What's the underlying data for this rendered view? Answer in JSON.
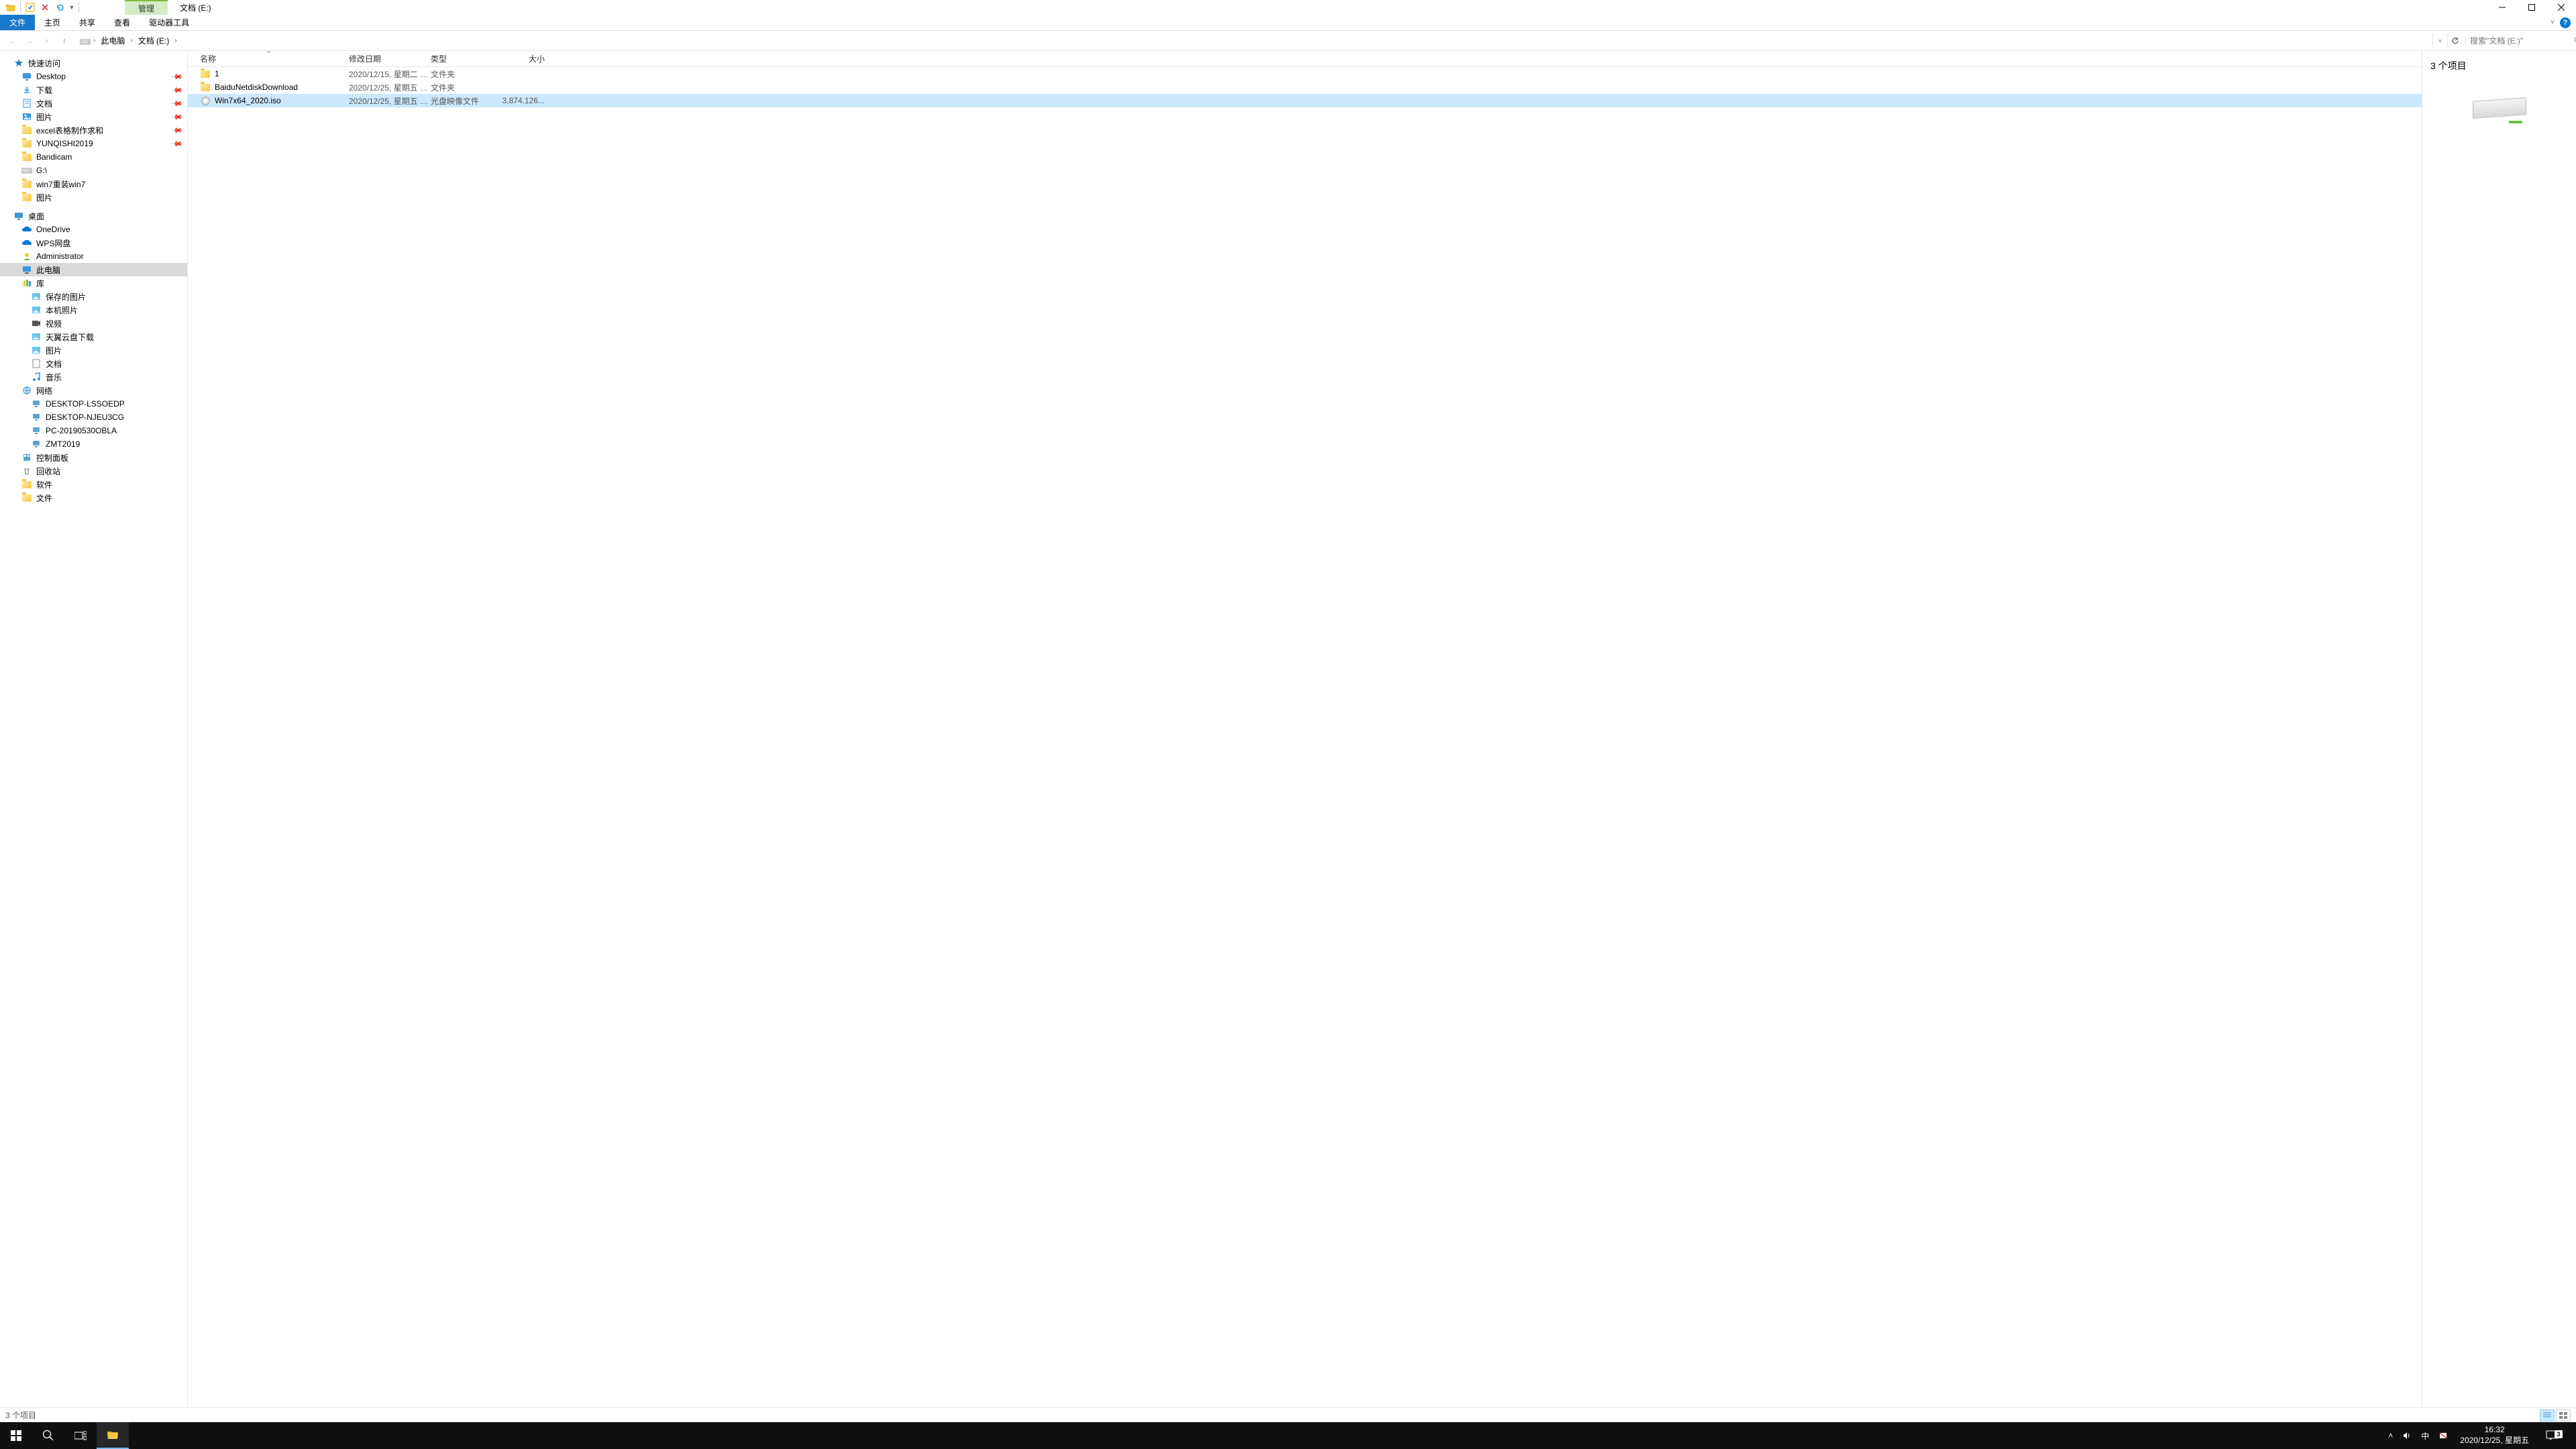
{
  "titlebar": {
    "context_tab": "管理",
    "title": "文档 (E:)"
  },
  "ribbon": {
    "file": "文件",
    "tabs": [
      "主页",
      "共享",
      "查看",
      "驱动器工具"
    ]
  },
  "address": {
    "segments": [
      "此电脑",
      "文档 (E:)"
    ]
  },
  "search": {
    "placeholder": "搜索\"文档 (E:)\""
  },
  "tree": {
    "quick_access": "快速访问",
    "quick_items": [
      {
        "label": "Desktop",
        "icon": "desktop",
        "pinned": true
      },
      {
        "label": "下载",
        "icon": "download",
        "pinned": true
      },
      {
        "label": "文档",
        "icon": "doc",
        "pinned": true
      },
      {
        "label": "图片",
        "icon": "pic",
        "pinned": true
      },
      {
        "label": "excel表格制作求和",
        "icon": "folder",
        "pinned": true
      },
      {
        "label": "YUNQISHI2019",
        "icon": "folder",
        "pinned": true
      },
      {
        "label": "Bandicam",
        "icon": "folder",
        "pinned": false
      },
      {
        "label": "G:\\",
        "icon": "drive",
        "pinned": false
      },
      {
        "label": "win7重装win7",
        "icon": "folder",
        "pinned": false
      },
      {
        "label": "图片",
        "icon": "folder",
        "pinned": false
      }
    ],
    "desktop": "桌面",
    "desktop_items": [
      {
        "label": "OneDrive",
        "icon": "cloud-blue"
      },
      {
        "label": "WPS网盘",
        "icon": "cloud-blue"
      },
      {
        "label": "Administrator",
        "icon": "user"
      },
      {
        "label": "此电脑",
        "icon": "pc",
        "selected": true
      },
      {
        "label": "库",
        "icon": "library"
      }
    ],
    "library_items": [
      {
        "label": "保存的图片",
        "icon": "picfile"
      },
      {
        "label": "本机照片",
        "icon": "picfile"
      },
      {
        "label": "视频",
        "icon": "video"
      },
      {
        "label": "天翼云盘下载",
        "icon": "picfile"
      },
      {
        "label": "图片",
        "icon": "picfile"
      },
      {
        "label": "文档",
        "icon": "docfile"
      },
      {
        "label": "音乐",
        "icon": "music"
      }
    ],
    "network": "网络",
    "network_items": [
      {
        "label": "DESKTOP-LSSOEDP",
        "icon": "netpc"
      },
      {
        "label": "DESKTOP-NJEU3CG",
        "icon": "netpc"
      },
      {
        "label": "PC-20190530OBLA",
        "icon": "netpc"
      },
      {
        "label": "ZMT2019",
        "icon": "netpc"
      }
    ],
    "cp": "控制面板",
    "recycle": "回收站",
    "software": "软件",
    "docs": "文件"
  },
  "columns": {
    "name": "名称",
    "date": "修改日期",
    "type": "类型",
    "size": "大小"
  },
  "files": [
    {
      "name": "1",
      "date": "2020/12/15, 星期二 1...",
      "type": "文件夹",
      "size": "",
      "icon": "folder"
    },
    {
      "name": "BaiduNetdiskDownload",
      "date": "2020/12/25, 星期五 1...",
      "type": "文件夹",
      "size": "",
      "icon": "folder"
    },
    {
      "name": "Win7x64_2020.iso",
      "date": "2020/12/25, 星期五 1...",
      "type": "光盘映像文件",
      "size": "3,874,126...",
      "icon": "disc",
      "selected": true
    }
  ],
  "preview": {
    "header": "3 个项目"
  },
  "statusbar": {
    "text": "3 个项目"
  },
  "taskbar": {
    "time": "16:32",
    "date": "2020/12/25, 星期五",
    "ime": "中",
    "notif_count": "3"
  }
}
